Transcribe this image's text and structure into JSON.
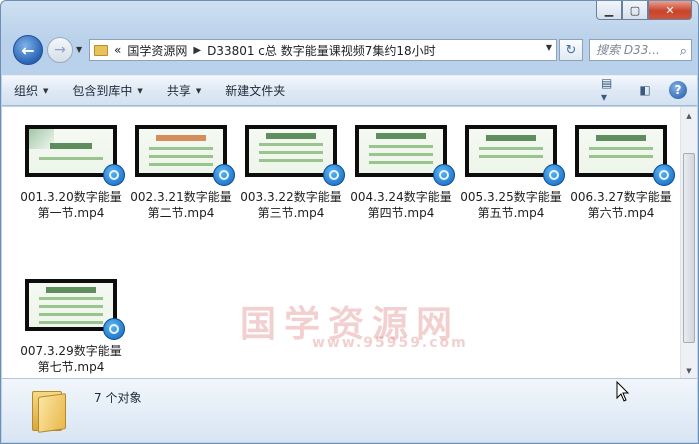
{
  "address": {
    "prefix": "«",
    "crumbs": [
      "国学资源网",
      "D33801 c总 数字能量课视频7集约18小时"
    ]
  },
  "search": {
    "placeholder": "搜索 D33..."
  },
  "toolbar": {
    "organize": "组织",
    "include_in_library": "包含到库中",
    "share": "共享",
    "new_folder": "新建文件夹"
  },
  "files": [
    {
      "name": "001.3.20数字能量第一节.mp4"
    },
    {
      "name": "002.3.21数字能量第二节.mp4"
    },
    {
      "name": "003.3.22数字能量第三节.mp4"
    },
    {
      "name": "004.3.24数字能量第四节.mp4"
    },
    {
      "name": "005.3.25数字能量第五节.mp4"
    },
    {
      "name": "006.3.27数字能量第六节.mp4"
    },
    {
      "name": "007.3.29数字能量第七节.mp4"
    }
  ],
  "watermark": {
    "text": "国学资源网",
    "url": "www.95959.com"
  },
  "status": {
    "count_text": "7 个对象"
  }
}
